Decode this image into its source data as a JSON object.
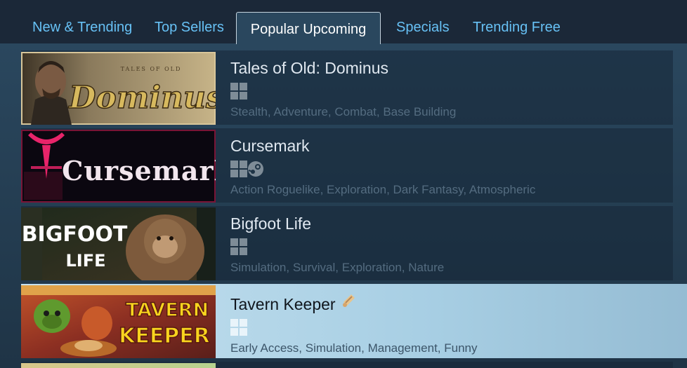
{
  "tabs": [
    {
      "label": "New & Trending"
    },
    {
      "label": "Top Sellers"
    },
    {
      "label": "Popular Upcoming"
    },
    {
      "label": "Specials"
    },
    {
      "label": "Trending Free"
    }
  ],
  "active_tab": "Popular Upcoming",
  "games": [
    {
      "title": "Tales of Old: Dominus",
      "platforms": [
        "windows-icon"
      ],
      "tags": "Stealth, Adventure, Combat, Base Building",
      "capsule_text": {
        "small": "TALES OF OLD",
        "main": "Dominus"
      }
    },
    {
      "title": "Cursemark",
      "platforms": [
        "windows-icon",
        "steam-icon"
      ],
      "tags": "Action Roguelike, Exploration, Dark Fantasy, Atmospheric",
      "capsule_text": {
        "main": "Cursemark"
      }
    },
    {
      "title": "Bigfoot Life",
      "platforms": [
        "windows-icon"
      ],
      "tags": "Simulation, Survival, Exploration, Nature",
      "capsule_text": {
        "line1": "BIGFOOT",
        "line2": "LIFE"
      }
    },
    {
      "title": "Tavern Keeper",
      "platforms": [
        "windows-icon"
      ],
      "tags": "Early Access, Simulation, Management, Funny",
      "badge_icon": "early-access-icon",
      "capsule_text": {
        "line1": "TAVERN",
        "line2": "KEEPER"
      }
    }
  ],
  "colors": {
    "background": "#1b2838",
    "tab_text": "#67c1f5",
    "active_tab_text": "#ffffff",
    "highlight_row": "#a8cfe4"
  }
}
